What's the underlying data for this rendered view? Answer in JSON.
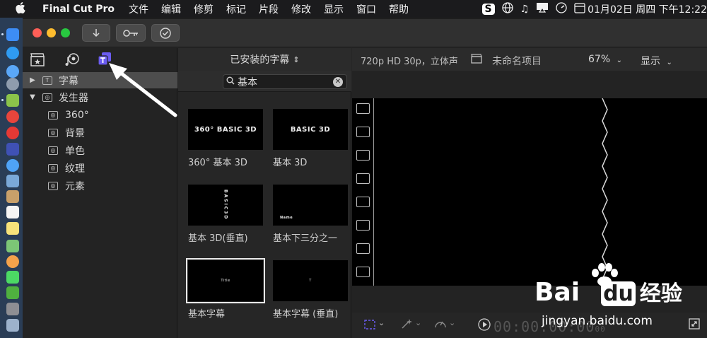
{
  "menubar": {
    "app_name": "Final Cut Pro",
    "items": [
      "文件",
      "编辑",
      "修剪",
      "标记",
      "片段",
      "修改",
      "显示",
      "窗口",
      "帮助"
    ],
    "datetime": "01月02日 周四 下午12:22",
    "status_icons": [
      "s-icon",
      "globe-icon",
      "music-icon",
      "display-icon",
      "timer-icon",
      "calendar-icon"
    ]
  },
  "sidebar": {
    "tabs": [
      "clapper-star-icon",
      "music-camera-icon",
      "titles-generators-icon"
    ],
    "items": [
      {
        "label": "字幕",
        "level": 0,
        "expanded": false,
        "selected": true,
        "icon": "T"
      },
      {
        "label": "发生器",
        "level": 0,
        "expanded": true,
        "selected": false,
        "icon": "◎"
      },
      {
        "label": "360°",
        "level": 1,
        "icon": "◎"
      },
      {
        "label": "背景",
        "level": 1,
        "icon": "◎"
      },
      {
        "label": "单色",
        "level": 1,
        "icon": "◎"
      },
      {
        "label": "纹理",
        "level": 1,
        "icon": "◎"
      },
      {
        "label": "元素",
        "level": 1,
        "icon": "◎"
      }
    ]
  },
  "browser": {
    "header": "已安装的字幕",
    "search_value": "基本",
    "tiles": [
      {
        "label": "360° 基本 3D",
        "thumb_text": "360° BASIC 3D",
        "selected": false
      },
      {
        "label": "基本 3D",
        "thumb_text": "BASIC 3D",
        "selected": false
      },
      {
        "label": "基本 3D(垂直)",
        "thumb_text": "BASIC3D",
        "selected": false
      },
      {
        "label": "基本下三分之一",
        "thumb_text": "Name",
        "selected": false
      },
      {
        "label": "基本字幕",
        "thumb_text": "Title",
        "selected": true
      },
      {
        "label": "基本字幕 (垂直)",
        "thumb_text": "T",
        "selected": false
      }
    ]
  },
  "viewer": {
    "format": "720p HD 30p，立体声",
    "project": "未命名项目",
    "zoom": "67%",
    "display_menu": "显示",
    "timecode": "00:00:00:00",
    "timecode_frames": "00"
  },
  "watermark": {
    "brand": "Bai",
    "brand2": "du",
    "cn": "经验",
    "url": "jingyan.baidu.com"
  },
  "colors": {
    "accent_purple": "#6b5cf0",
    "close": "#ff5f57",
    "minimize": "#febc2e",
    "zoom": "#28c840"
  }
}
